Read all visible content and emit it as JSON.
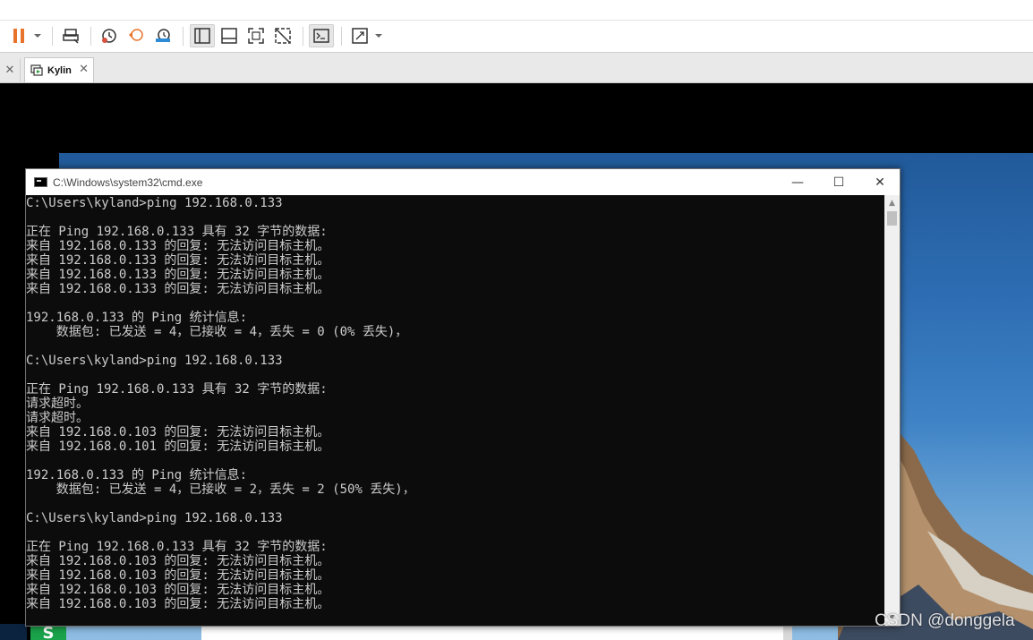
{
  "toolbar": {
    "buttons": [
      "pause-icon",
      "dropdown-caret-icon",
      "send-keys-icon",
      "snapshot-icon",
      "revert-snapshot-icon",
      "snapshot-manager-icon",
      "library-view-icon",
      "console-view-icon",
      "fullscreen-icon",
      "unity-icon",
      "terminal-icon",
      "stretch-icon"
    ],
    "accent": "#e8742c"
  },
  "tabs": {
    "active_label": "Kylin",
    "close_glyph": "✕"
  },
  "cmd_window": {
    "title": "C:\\Windows\\system32\\cmd.exe",
    "minimize_glyph": "—",
    "maximize_glyph": "☐",
    "close_glyph": "✕",
    "lines": [
      "C:\\Users\\kyland>ping 192.168.0.133",
      "",
      "正在 Ping 192.168.0.133 具有 32 字节的数据:",
      "来自 192.168.0.133 的回复: 无法访问目标主机。",
      "来自 192.168.0.133 的回复: 无法访问目标主机。",
      "来自 192.168.0.133 的回复: 无法访问目标主机。",
      "来自 192.168.0.133 的回复: 无法访问目标主机。",
      "",
      "192.168.0.133 的 Ping 统计信息:",
      "    数据包: 已发送 = 4，已接收 = 4，丢失 = 0 (0% 丢失)，",
      "",
      "C:\\Users\\kyland>ping 192.168.0.133",
      "",
      "正在 Ping 192.168.0.133 具有 32 字节的数据:",
      "请求超时。",
      "请求超时。",
      "来自 192.168.0.103 的回复: 无法访问目标主机。",
      "来自 192.168.0.101 的回复: 无法访问目标主机。",
      "",
      "192.168.0.133 的 Ping 统计信息:",
      "    数据包: 已发送 = 4，已接收 = 2，丢失 = 2 (50% 丢失)，",
      "",
      "C:\\Users\\kyland>ping 192.168.0.133",
      "",
      "正在 Ping 192.168.0.133 具有 32 字节的数据:",
      "来自 192.168.0.103 的回复: 无法访问目标主机。",
      "来自 192.168.0.103 的回复: 无法访问目标主机。",
      "来自 192.168.0.103 的回复: 无法访问目标主机。",
      "来自 192.168.0.103 的回复: 无法访问目标主机。"
    ]
  },
  "desktop": {
    "app_icon_letter": "S"
  },
  "watermark": "CSDN @donggela"
}
